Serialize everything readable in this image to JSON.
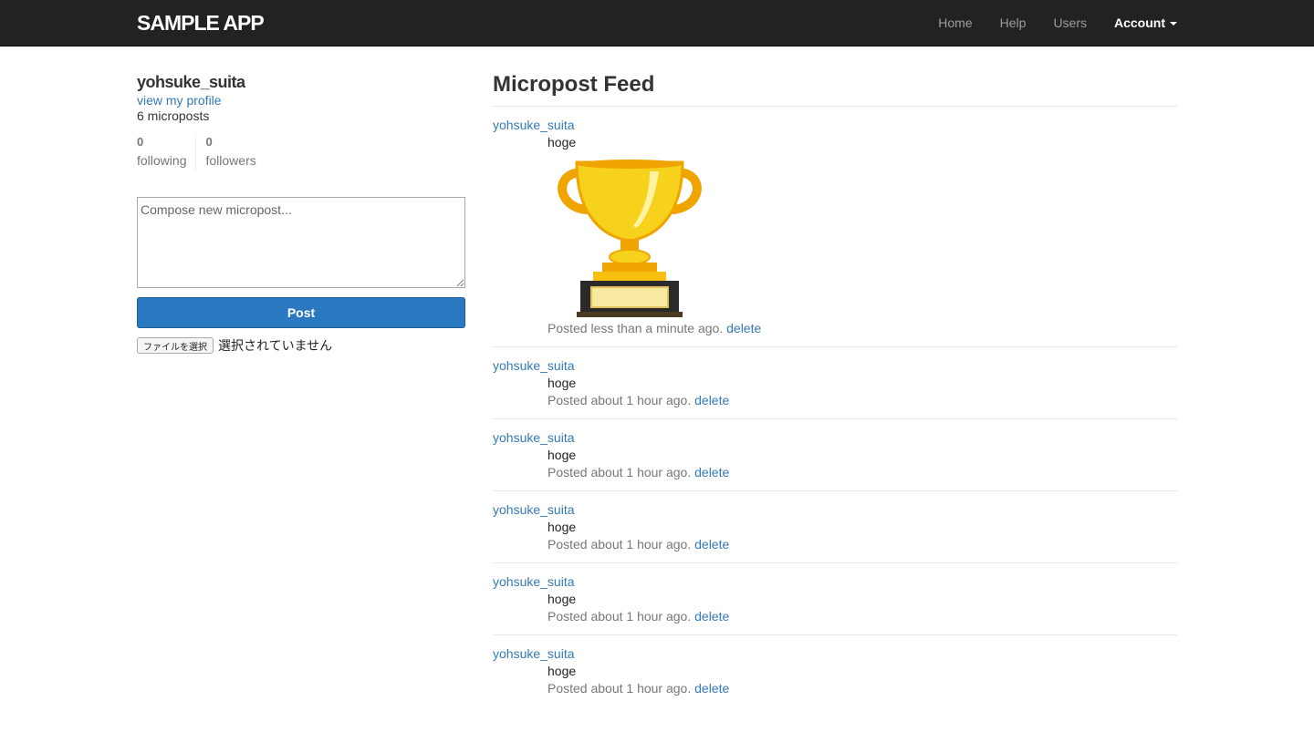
{
  "navbar": {
    "logo": "SAMPLE APP",
    "links": [
      {
        "label": "Home"
      },
      {
        "label": "Help"
      },
      {
        "label": "Users"
      },
      {
        "label": "Account"
      }
    ]
  },
  "sidebar": {
    "user_name": "yohsuke_suita",
    "profile_link": "view my profile",
    "post_count": "6 microposts",
    "following_count": "0",
    "following_label": "following",
    "followers_count": "0",
    "followers_label": "followers",
    "compose_placeholder": "Compose new micropost...",
    "post_button": "Post",
    "file_button": "ファイルを選択",
    "file_status": "選択されていません"
  },
  "feed": {
    "title": "Micropost Feed",
    "posts": [
      {
        "user": "yohsuke_suita",
        "content": "hoge",
        "image": "trophy",
        "time": "Posted less than a minute ago.",
        "delete": "delete"
      },
      {
        "user": "yohsuke_suita",
        "content": "hoge",
        "time": "Posted about 1 hour ago.",
        "delete": "delete"
      },
      {
        "user": "yohsuke_suita",
        "content": "hoge",
        "time": "Posted about 1 hour ago.",
        "delete": "delete"
      },
      {
        "user": "yohsuke_suita",
        "content": "hoge",
        "time": "Posted about 1 hour ago.",
        "delete": "delete"
      },
      {
        "user": "yohsuke_suita",
        "content": "hoge",
        "time": "Posted about 1 hour ago.",
        "delete": "delete"
      },
      {
        "user": "yohsuke_suita",
        "content": "hoge",
        "time": "Posted about 1 hour ago.",
        "delete": "delete"
      }
    ]
  },
  "colors": {
    "navbar": "#222222",
    "link": "#337ab7",
    "primary_button": "#2a78c0"
  }
}
